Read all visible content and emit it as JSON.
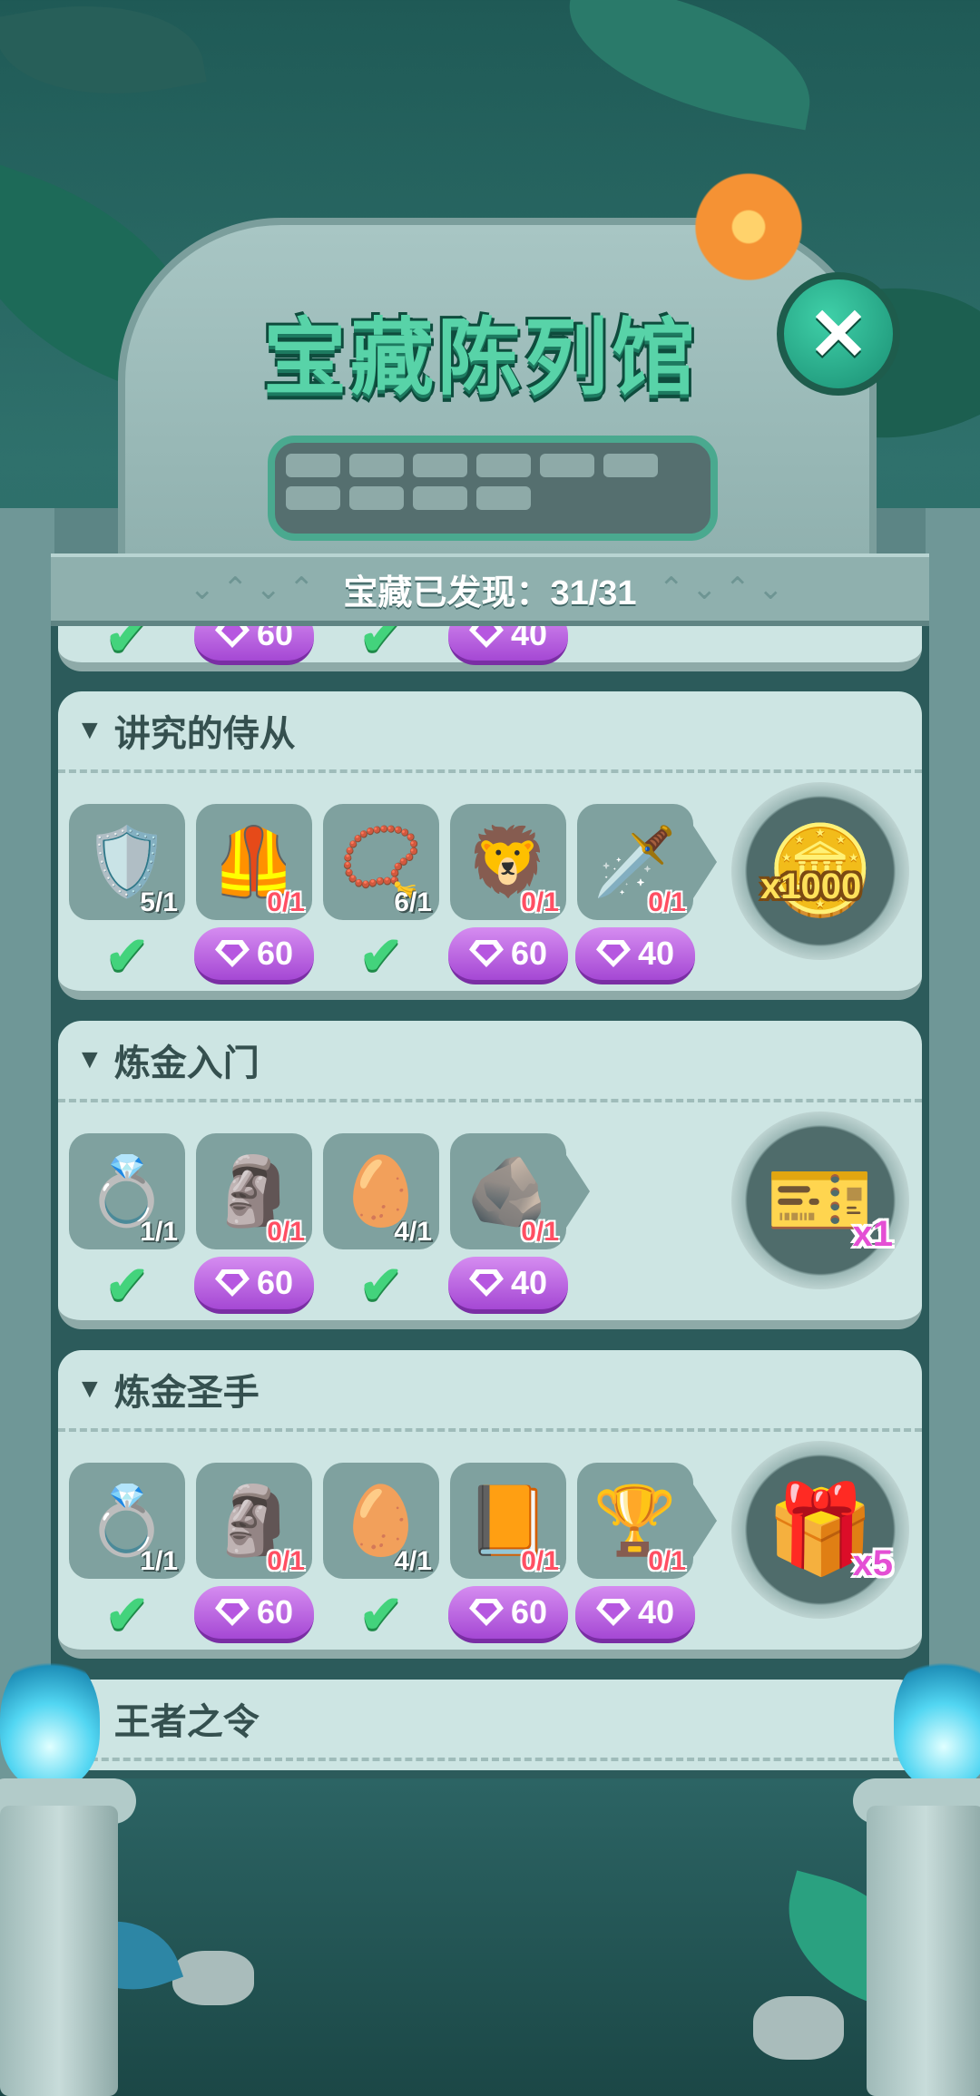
{
  "header": {
    "title": "宝藏陈列馆",
    "close_label": "✕",
    "discovered_label": "宝藏已发现：31/31"
  },
  "partial_top": {
    "prices": [
      "60",
      "40"
    ]
  },
  "sections": [
    {
      "name": "讲究的侍从",
      "items": [
        {
          "icon": "mickey-shield-icon",
          "glyph": "🛡️",
          "count": "5/1",
          "state": "check"
        },
        {
          "icon": "golden-armor-icon",
          "glyph": "🦺",
          "count": "0/1",
          "state": "price",
          "price": "60"
        },
        {
          "icon": "golden-belt-icon",
          "glyph": "📿",
          "count": "6/1",
          "state": "check"
        },
        {
          "icon": "lion-medallion-icon",
          "glyph": "🦁",
          "count": "0/1",
          "state": "price",
          "price": "60"
        },
        {
          "icon": "crystal-sword-icon",
          "glyph": "🗡️",
          "count": "0/1",
          "state": "price",
          "price": "40"
        }
      ],
      "reward": {
        "icon": "gold-coins-icon",
        "glyph": "🪙",
        "qty": "x1000"
      }
    },
    {
      "name": "炼金入门",
      "items": [
        {
          "icon": "bone-ring-icon",
          "glyph": "💍",
          "count": "1/1",
          "state": "check"
        },
        {
          "icon": "tiki-mask-icon",
          "glyph": "🗿",
          "count": "0/1",
          "state": "price",
          "price": "60"
        },
        {
          "icon": "tribal-shield-icon",
          "glyph": "🥚",
          "count": "4/1",
          "state": "check"
        },
        {
          "icon": "stone-tablet-icon",
          "glyph": "🪨",
          "count": "0/1",
          "state": "price",
          "price": "40"
        }
      ],
      "reward": {
        "icon": "mickey-ticket-icon",
        "glyph": "🎫",
        "qty": "x1"
      }
    },
    {
      "name": "炼金圣手",
      "items": [
        {
          "icon": "bone-ring-icon",
          "glyph": "💍",
          "count": "1/1",
          "state": "check"
        },
        {
          "icon": "tiki-mask-icon",
          "glyph": "🗿",
          "count": "0/1",
          "state": "price",
          "price": "60"
        },
        {
          "icon": "tribal-shield-icon",
          "glyph": "🥚",
          "count": "4/1",
          "state": "check"
        },
        {
          "icon": "spell-book-icon",
          "glyph": "📙",
          "count": "0/1",
          "state": "price",
          "price": "60"
        },
        {
          "icon": "golden-trophy-icon",
          "glyph": "🏆",
          "count": "0/1",
          "state": "price",
          "price": "40"
        }
      ],
      "reward": {
        "icon": "mystery-box-icon",
        "glyph": "🎁",
        "qty": "x5"
      }
    },
    {
      "name": "王者之令",
      "items": [],
      "reward": null
    }
  ]
}
